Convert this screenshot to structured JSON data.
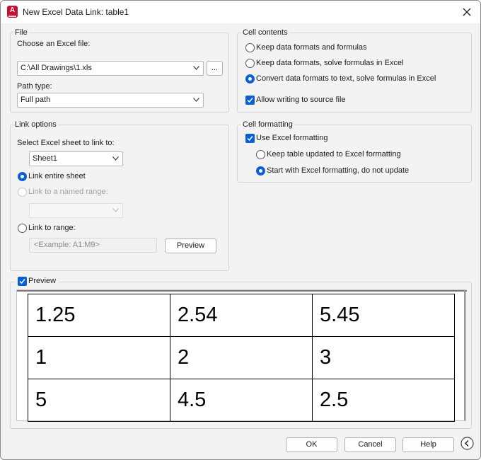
{
  "window": {
    "title": "New Excel Data Link: table1"
  },
  "file_group": {
    "legend": "File",
    "choose_label": "Choose an Excel file:",
    "file_path": "C:\\All Drawings\\1.xls",
    "browse_label": "...",
    "path_type_label": "Path type:",
    "path_type_value": "Full path"
  },
  "link_options": {
    "legend": "Link options",
    "select_sheet_label": "Select Excel sheet to link to:",
    "sheet_value": "Sheet1",
    "link_entire_sheet": "Link entire sheet",
    "link_named_range": "Link to a named range:",
    "named_range_value": "",
    "link_to_range": "Link to range:",
    "range_placeholder": "<Example: A1:M9>",
    "preview_button": "Preview"
  },
  "cell_contents": {
    "legend": "Cell contents",
    "options": [
      {
        "label": "Keep data formats and formulas",
        "selected": false
      },
      {
        "label": "Keep data formats, solve formulas in Excel",
        "selected": false
      },
      {
        "label": "Convert data formats to text, solve formulas in Excel",
        "selected": true
      }
    ],
    "allow_writing": {
      "label": "Allow writing to source file",
      "checked": true
    }
  },
  "cell_formatting": {
    "legend": "Cell formatting",
    "use_excel_formatting": {
      "label": "Use Excel formatting",
      "checked": true
    },
    "options": [
      {
        "label": "Keep table updated to Excel formatting",
        "selected": false
      },
      {
        "label": "Start with Excel formatting, do not update",
        "selected": true
      }
    ]
  },
  "preview": {
    "label": "Preview",
    "checked": true,
    "rows": [
      [
        "1.25",
        "2.54",
        "5.45"
      ],
      [
        "1",
        "2",
        "3"
      ],
      [
        "5",
        "4.5",
        "2.5"
      ]
    ]
  },
  "footer": {
    "ok": "OK",
    "cancel": "Cancel",
    "help": "Help"
  },
  "colors": {
    "accent": "#0a5fd6",
    "app_icon": "#c8102e"
  },
  "icons": {
    "app": "autocad-app-icon",
    "close": "close-icon",
    "dropdown": "chevron-down-icon",
    "collapse": "chevron-left-circle-icon"
  }
}
